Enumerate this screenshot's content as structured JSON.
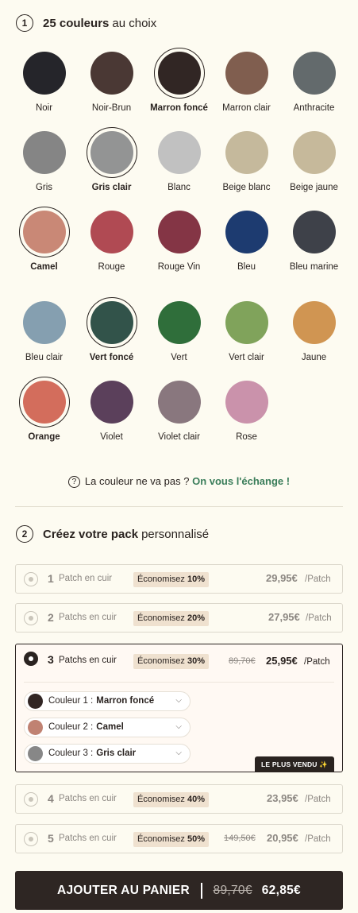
{
  "step1": {
    "num": "1",
    "bold": "25 couleurs",
    "rest": "au choix"
  },
  "colors": [
    [
      {
        "name": "Noir",
        "hex": "#25252a",
        "selected": false
      },
      {
        "name": "Noir-Brun",
        "hex": "#4a3834",
        "selected": false
      },
      {
        "name": "Marron foncé",
        "hex": "#312624",
        "selected": true
      },
      {
        "name": "Marron clair",
        "hex": "#805e4f",
        "selected": false
      },
      {
        "name": "Anthracite",
        "hex": "#636a6c",
        "selected": false
      }
    ],
    [
      {
        "name": "Gris",
        "hex": "#858585",
        "selected": false
      },
      {
        "name": "Gris clair",
        "hex": "#939494",
        "selected": true
      },
      {
        "name": "Blanc",
        "hex": "#c1c1c1",
        "selected": false
      },
      {
        "name": "Beige blanc",
        "hex": "#c5b99c",
        "selected": false
      },
      {
        "name": "Beige jaune",
        "hex": "#c6b99b",
        "selected": false
      }
    ],
    [
      {
        "name": "Camel",
        "hex": "#c98876",
        "selected": true
      },
      {
        "name": "Rouge",
        "hex": "#b04a53",
        "selected": false
      },
      {
        "name": "Rouge Vin",
        "hex": "#843545",
        "selected": false
      },
      {
        "name": "Bleu",
        "hex": "#1d3b70",
        "selected": false
      },
      {
        "name": "Bleu marine",
        "hex": "#3e4149",
        "selected": false
      }
    ],
    [
      {
        "name": "Bleu clair",
        "hex": "#859fb0",
        "selected": false
      },
      {
        "name": "Vert foncé",
        "hex": "#32534a",
        "selected": true
      },
      {
        "name": "Vert",
        "hex": "#2f6e3a",
        "selected": false
      },
      {
        "name": "Vert clair",
        "hex": "#80a35b",
        "selected": false
      },
      {
        "name": "Jaune",
        "hex": "#d09552",
        "selected": false
      }
    ],
    [
      {
        "name": "Orange",
        "hex": "#d36d5c",
        "selected": true
      },
      {
        "name": "Violet",
        "hex": "#5b405b",
        "selected": false
      },
      {
        "name": "Violet clair",
        "hex": "#89777e",
        "selected": false
      },
      {
        "name": "Rose",
        "hex": "#ca92ab",
        "selected": false
      }
    ]
  ],
  "exchange": {
    "icon": "question-circle-icon",
    "text": "La couleur ne va pas ?",
    "link": "On vous l'échange !"
  },
  "step2": {
    "num": "2",
    "bold": "Créez votre pack",
    "rest": "personnalisé"
  },
  "packs": [
    {
      "qty": "1",
      "label": "Patch en cuir",
      "badge_prefix": "Économisez",
      "badge_pct": "10%",
      "old": "",
      "price": "29,95€",
      "per": "/Patch"
    },
    {
      "qty": "2",
      "label": "Patchs en cuir",
      "badge_prefix": "Économisez",
      "badge_pct": "20%",
      "old": "",
      "price": "27,95€",
      "per": "/Patch"
    },
    {
      "qty": "3",
      "label": "Patchs en cuir",
      "badge_prefix": "Économisez",
      "badge_pct": "30%",
      "old": "89,70€",
      "price": "25,95€",
      "per": "/Patch"
    },
    {
      "qty": "4",
      "label": "Patchs en cuir",
      "badge_prefix": "Économisez",
      "badge_pct": "40%",
      "old": "",
      "price": "23,95€",
      "per": "/Patch"
    },
    {
      "qty": "5",
      "label": "Patchs en cuir",
      "badge_prefix": "Économisez",
      "badge_pct": "50%",
      "old": "149,50€",
      "price": "20,95€",
      "per": "/Patch"
    }
  ],
  "selectors": [
    {
      "label": "Couleur 1 :",
      "value": "Marron foncé",
      "hex": "#312624"
    },
    {
      "label": "Couleur 2 :",
      "value": "Camel",
      "hex": "#c08272"
    },
    {
      "label": "Couleur 3 :",
      "value": "Gris clair",
      "hex": "#878787"
    }
  ],
  "best_seller": "LE PLUS VENDU ✨",
  "cart": {
    "label": "AJOUTER AU PANIER",
    "old": "89,70€",
    "price": "62,85€"
  }
}
